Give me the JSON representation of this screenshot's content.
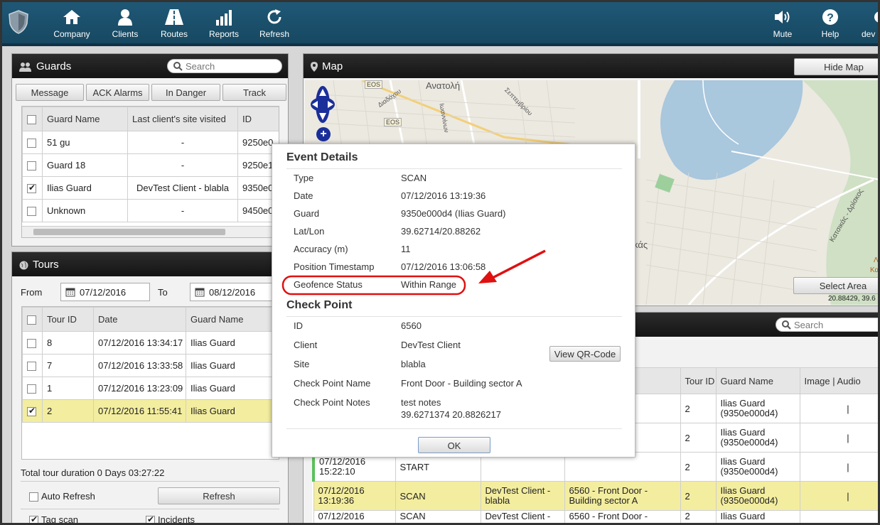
{
  "nav": {
    "items": [
      {
        "label": "Company",
        "icon": "home-icon"
      },
      {
        "label": "Clients",
        "icon": "user-icon"
      },
      {
        "label": "Routes",
        "icon": "road-icon"
      },
      {
        "label": "Reports",
        "icon": "bar-chart-icon"
      },
      {
        "label": "Refresh",
        "icon": "refresh-icon"
      }
    ],
    "right": [
      {
        "label": "Mute",
        "icon": "volume-icon"
      },
      {
        "label": "Help",
        "icon": "help-icon"
      },
      {
        "label": "dev",
        "icon": "gear-icon"
      }
    ]
  },
  "guards": {
    "title": "Guards",
    "search_placeholder": "Search",
    "buttons": [
      "Message",
      "ACK Alarms",
      "In Danger",
      "Track"
    ],
    "columns": [
      "Guard Name",
      "Last client's site visited",
      "ID"
    ],
    "rows": [
      {
        "name": "51 gu",
        "site": "-",
        "id": "9250e0",
        "checked": false
      },
      {
        "name": "Guard 18",
        "site": "-",
        "id": "9250e1",
        "checked": false
      },
      {
        "name": "Ilias Guard",
        "site": "DevTest Client - blabla",
        "id": "9350e0",
        "checked": true
      },
      {
        "name": "Unknown",
        "site": "-",
        "id": "9450e0",
        "checked": false
      }
    ]
  },
  "tours": {
    "title": "Tours",
    "from_label": "From",
    "from_value": "07/12/2016",
    "to_label": "To",
    "to_value": "08/12/2016",
    "columns": [
      "Tour ID",
      "Date",
      "Guard Name"
    ],
    "rows": [
      {
        "id": "8",
        "date": "07/12/2016 13:34:17",
        "guard": "Ilias Guard"
      },
      {
        "id": "7",
        "date": "07/12/2016 13:33:58",
        "guard": "Ilias Guard"
      },
      {
        "id": "1",
        "date": "07/12/2016 13:23:09",
        "guard": "Ilias Guard"
      },
      {
        "id": "2",
        "date": "07/12/2016 11:55:41",
        "guard": "Ilias Guard"
      }
    ],
    "duration": "Total tour duration 0 Days 03:27:22",
    "auto_refresh": "Auto Refresh",
    "refresh": "Refresh",
    "tag_scan": "Tag scan",
    "incidents": "Incidents"
  },
  "map": {
    "title": "Map",
    "hide_button": "Hide Map",
    "select_area": "Select Area",
    "coords": "20.88429, 39.6",
    "labels": [
      "Ανατολή",
      "EOS",
      "EOS",
      "Κατσικάς - Δρίσκος",
      "Λα",
      "Καστ",
      "Ιωαννίνων",
      "κάς",
      "Σεπτεμβρίου",
      "Διαδόχου"
    ]
  },
  "events": {
    "search_placeholder": "Search",
    "columns": [
      "Tour ID",
      "Guard Name",
      "Image | Audio"
    ],
    "rows": [
      {
        "date": "",
        "type": "",
        "client": "",
        "checkpoint": "",
        "tour": "2",
        "guard": "Ilias Guard\n(9350e000d4)"
      },
      {
        "date": "",
        "type": "",
        "client": "",
        "checkpoint": "",
        "tour": "2",
        "guard": "Ilias Guard\n(9350e000d4)"
      },
      {
        "date": "07/12/2016\n15:22:10",
        "type": "START",
        "client": "",
        "checkpoint": "",
        "tour": "2",
        "guard": "Ilias Guard\n(9350e000d4)"
      },
      {
        "date": "07/12/2016\n13:19:36",
        "type": "SCAN",
        "client": "DevTest Client -\nblabla",
        "checkpoint": "6560 - Front Door -\nBuilding sector A",
        "tour": "2",
        "guard": "Ilias Guard\n(9350e000d4)"
      },
      {
        "date": "07/12/2016",
        "type": "SCAN",
        "client": "DevTest Client -",
        "checkpoint": "6560 - Front Door -",
        "tour": "2",
        "guard": "Ilias Guard"
      }
    ]
  },
  "dialog": {
    "event_title": "Event Details",
    "check_title": "Check Point",
    "event": [
      [
        "Type",
        "SCAN"
      ],
      [
        "Date",
        "07/12/2016 13:19:36"
      ],
      [
        "Guard",
        "9350e000d4 (Ilias Guard)"
      ],
      [
        "Lat/Lon",
        "39.62714/20.88262"
      ],
      [
        "Accuracy (m)",
        "11"
      ],
      [
        "Position Timestamp",
        "07/12/2016 13:06:58"
      ],
      [
        "Geofence Status",
        "Within Range"
      ]
    ],
    "check": [
      [
        "ID",
        "6560"
      ],
      [
        "Client",
        "DevTest Client"
      ],
      [
        "Site",
        "blabla"
      ],
      [
        "Check Point Name",
        "Front Door - Building sector A"
      ]
    ],
    "notes_label": "Check Point Notes",
    "notes_line1": "test notes",
    "notes_line2": "39.6271374 20.8826217",
    "qr_button": "View QR-Code",
    "ok_button": "OK"
  },
  "colors": {
    "topbar": "#1f5876",
    "highlight": "#f3ed9f",
    "annotation": "#e01010"
  }
}
